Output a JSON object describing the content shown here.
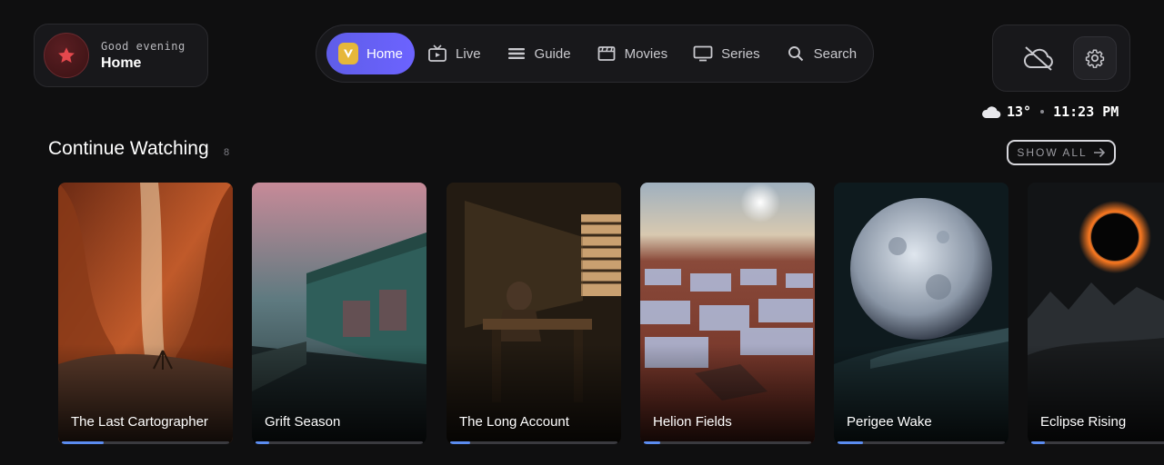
{
  "profile": {
    "greeting": "Good evening",
    "name": "Home",
    "avatar_icon": "star-icon"
  },
  "nav": {
    "items": [
      {
        "label": "Home",
        "icon": "vod-logo-icon",
        "active": true
      },
      {
        "label": "Live",
        "icon": "live-tv-icon",
        "active": false
      },
      {
        "label": "Guide",
        "icon": "guide-list-icon",
        "active": false
      },
      {
        "label": "Movies",
        "icon": "clapperboard-icon",
        "active": false
      },
      {
        "label": "Series",
        "icon": "monitor-icon",
        "active": false
      },
      {
        "label": "Search",
        "icon": "search-icon",
        "active": false
      }
    ]
  },
  "header_right": {
    "sync_icon": "cloud-off-icon",
    "settings_icon": "gear-icon"
  },
  "status": {
    "weather_icon": "cloud-icon",
    "temperature": "13°",
    "time": "11:23 PM"
  },
  "section": {
    "title": "Continue Watching",
    "count": "8",
    "show_all": "SHOW ALL"
  },
  "cards": [
    {
      "title": "The Last Cartographer",
      "progress": 0.25
    },
    {
      "title": "Grift Season",
      "progress": 0.08
    },
    {
      "title": "The Long Account",
      "progress": 0.12
    },
    {
      "title": "Helion Fields",
      "progress": 0.1
    },
    {
      "title": "Perigee Wake",
      "progress": 0.15
    },
    {
      "title": "Eclipse Rising",
      "progress": 0.08
    }
  ],
  "colors": {
    "accent": "#6c63ff",
    "progress": "#5b8cf0",
    "background": "#0f0f10"
  }
}
